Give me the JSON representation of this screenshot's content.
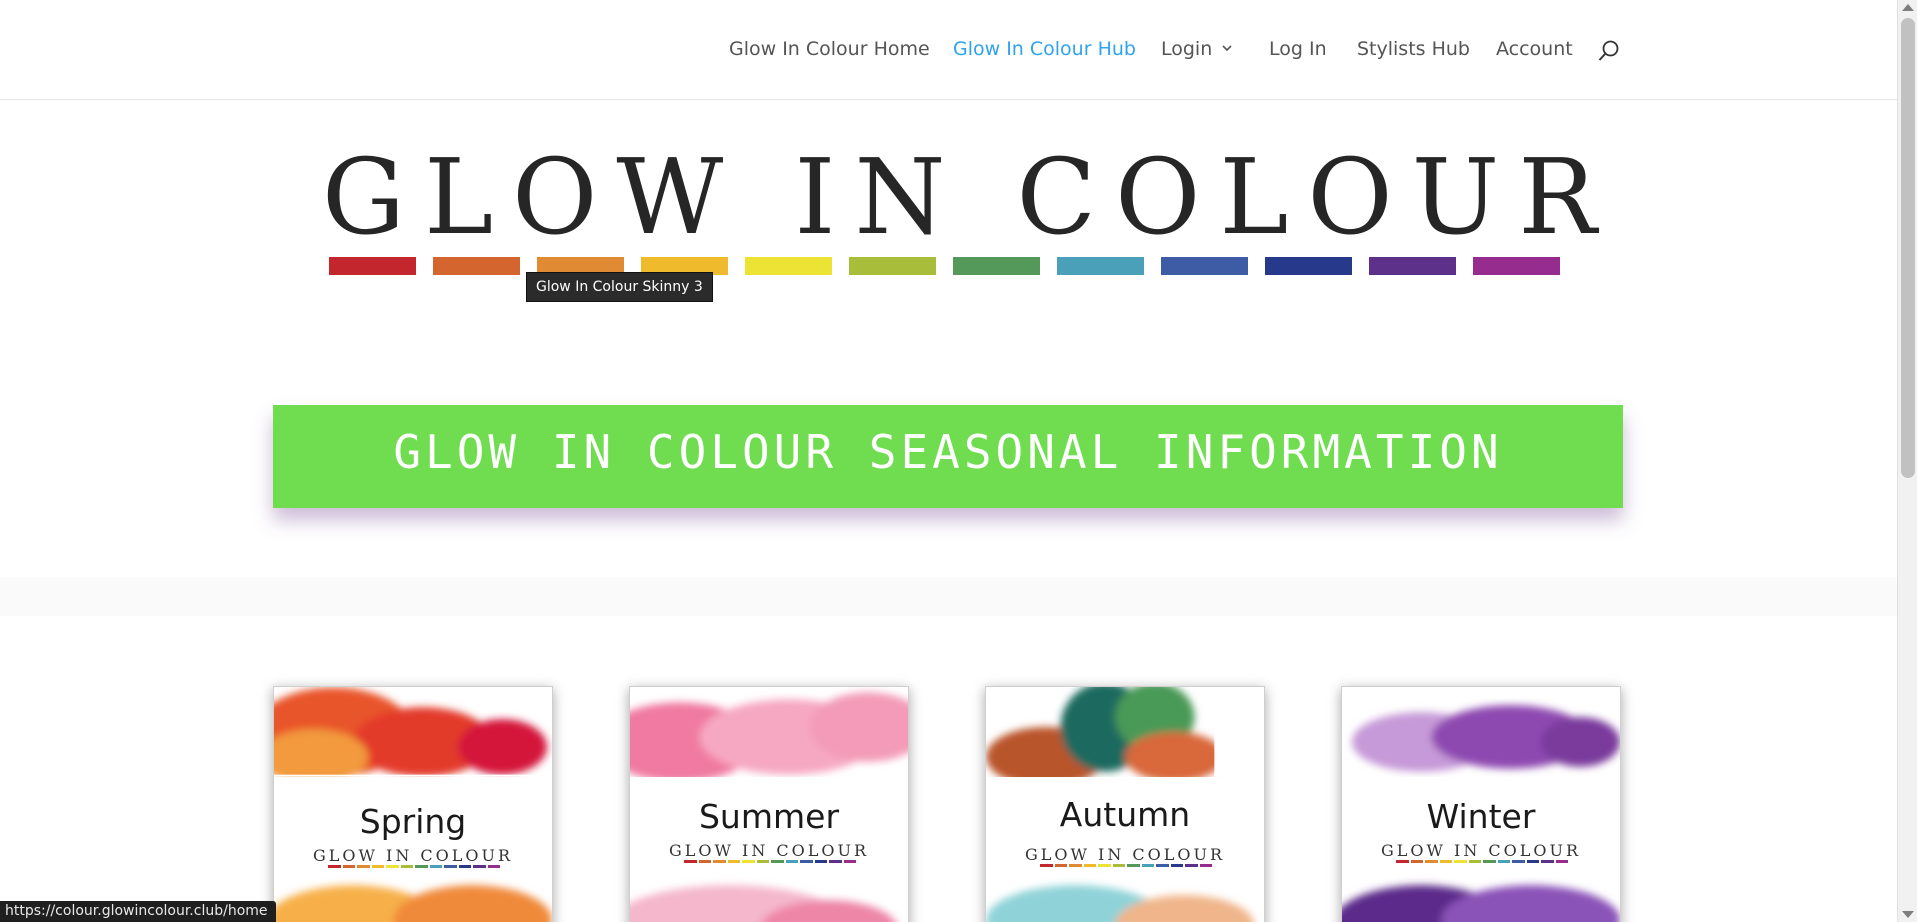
{
  "nav": {
    "items": [
      {
        "label": "Glow In Colour Home",
        "active": false
      },
      {
        "label": "Glow In Colour Hub",
        "active": true
      },
      {
        "label": "Login",
        "active": false,
        "has_dropdown": true
      },
      {
        "label": "Log In",
        "active": false
      },
      {
        "label": "Stylists Hub",
        "active": false
      },
      {
        "label": "Account",
        "active": false
      }
    ],
    "search_icon": "search-icon",
    "active_color": "#2ea3f2"
  },
  "logo": {
    "text": "GLOW IN COLOUR",
    "swatch_colors": [
      "#c4262e",
      "#d4652f",
      "#e08a33",
      "#efbb2c",
      "#ede334",
      "#a8bd3a",
      "#55995a",
      "#4aa0b8",
      "#3e5ba6",
      "#27398a",
      "#5d3189",
      "#962d8e"
    ]
  },
  "tooltip": {
    "text": "Glow In Colour Skinny 3"
  },
  "banner": {
    "title": "GLOW IN COLOUR SEASONAL INFORMATION",
    "color": "#70dc4f"
  },
  "seasons": [
    {
      "title": "Spring",
      "logo_text": "GLOW IN COLOUR"
    },
    {
      "title": "Summer",
      "logo_text": "GLOW IN COLOUR"
    },
    {
      "title": "Autumn",
      "logo_text": "GLOW IN COLOUR"
    },
    {
      "title": "Winter",
      "logo_text": "GLOW IN COLOUR"
    }
  ],
  "statusbar": {
    "url": "https://colour.glowincolour.club/home"
  }
}
